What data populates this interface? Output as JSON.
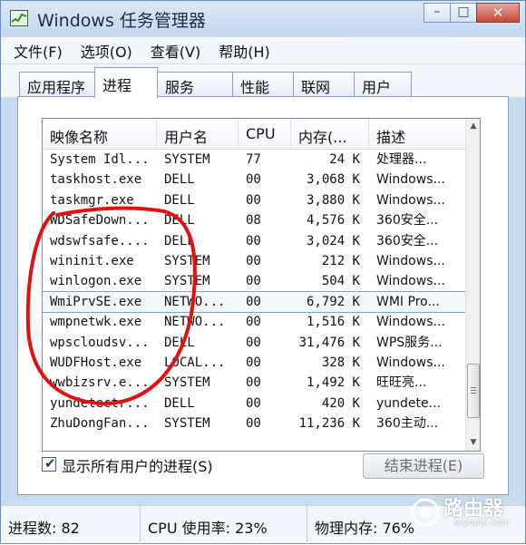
{
  "window": {
    "title": "Windows 任务管理器",
    "minimize_glyph": "–",
    "maximize_glyph": "□",
    "close_glyph": "✕"
  },
  "menu": [
    "文件(F)",
    "选项(O)",
    "查看(V)",
    "帮助(H)"
  ],
  "tabs": [
    {
      "label": "应用程序",
      "active": false
    },
    {
      "label": "进程",
      "active": true
    },
    {
      "label": "服务",
      "active": false
    },
    {
      "label": "性能",
      "active": false
    },
    {
      "label": "联网",
      "active": false
    },
    {
      "label": "用户",
      "active": false
    }
  ],
  "columns": [
    "映像名称",
    "用户名",
    "CPU",
    "内存(...",
    "描述"
  ],
  "processes": [
    {
      "name": "System Idl...",
      "user": "SYSTEM",
      "cpu": "77",
      "mem": "24 K",
      "desc": "处理器..."
    },
    {
      "name": "taskhost.exe",
      "user": "DELL",
      "cpu": "00",
      "mem": "3,068 K",
      "desc": "Windows..."
    },
    {
      "name": "taskmgr.exe",
      "user": "DELL",
      "cpu": "00",
      "mem": "3,880 K",
      "desc": "Windows..."
    },
    {
      "name": "WDSafeDown...",
      "user": "DELL",
      "cpu": "08",
      "mem": "4,576 K",
      "desc": "360安全..."
    },
    {
      "name": "wdswfsafe....",
      "user": "DELL",
      "cpu": "00",
      "mem": "3,024 K",
      "desc": "360安全..."
    },
    {
      "name": "wininit.exe",
      "user": "SYSTEM",
      "cpu": "00",
      "mem": "212 K",
      "desc": "Windows..."
    },
    {
      "name": "winlogon.exe",
      "user": "SYSTEM",
      "cpu": "00",
      "mem": "504 K",
      "desc": "Windows..."
    },
    {
      "name": "WmiPrvSE.exe",
      "user": "NETWO...",
      "cpu": "00",
      "mem": "6,792 K",
      "desc": "WMI Pro..."
    },
    {
      "name": "wmpnetwk.exe",
      "user": "NETWO...",
      "cpu": "00",
      "mem": "1,516 K",
      "desc": "Windows..."
    },
    {
      "name": "wpscloudsv...",
      "user": "DELL",
      "cpu": "00",
      "mem": "31,476 K",
      "desc": "WPS服务..."
    },
    {
      "name": "WUDFHost.exe",
      "user": "LOCAL...",
      "cpu": "00",
      "mem": "328 K",
      "desc": "Windows..."
    },
    {
      "name": "wwbizsrv.e...",
      "user": "SYSTEM",
      "cpu": "00",
      "mem": "1,492 K",
      "desc": "旺旺亮..."
    },
    {
      "name": "yundetectr...",
      "user": "DELL",
      "cpu": "00",
      "mem": "420 K",
      "desc": "yundete..."
    },
    {
      "name": "ZhuDongFan...",
      "user": "SYSTEM",
      "cpu": "00",
      "mem": "11,236 K",
      "desc": "360主动..."
    }
  ],
  "selected_row": 7,
  "show_all_users": {
    "label": "显示所有用户的进程(S)",
    "checked": true
  },
  "end_process_button": "结束进程(E)",
  "status": {
    "process_count": "进程数: 82",
    "cpu_usage": "CPU 使用率: 23%",
    "physical_memory": "物理内存: 76%"
  },
  "watermark": {
    "text": "路由器",
    "sub": "luyouqi.com"
  },
  "annotation_color": "#e31010"
}
